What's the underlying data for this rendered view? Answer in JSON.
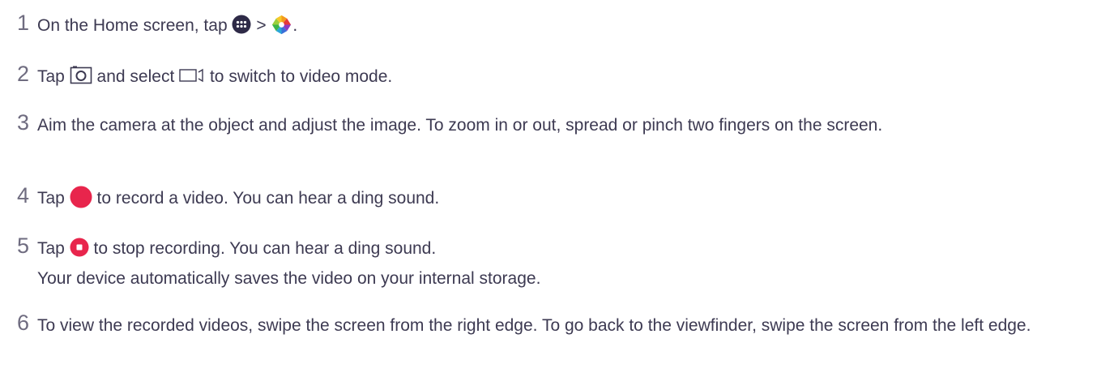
{
  "steps": [
    {
      "number": "1",
      "text_a": "On the Home screen, tap",
      "text_b": ">",
      "text_c": ".",
      "icons": [
        "apps-grid-icon",
        "gallery-aperture-icon"
      ]
    },
    {
      "number": "2",
      "text_a": "Tap",
      "text_b": "and select",
      "text_c": "to switch to video mode.",
      "icons": [
        "camera-mode-icon",
        "video-mode-icon"
      ]
    },
    {
      "number": "3",
      "text_a": "Aim the camera at the object and adjust the image. To zoom in or out, spread or pinch two fingers on the screen."
    },
    {
      "number": "4",
      "text_a": "Tap",
      "text_b": "to record a video. You can hear a ding sound.",
      "icons": [
        "record-button-icon"
      ]
    },
    {
      "number": "5",
      "text_a": "Tap",
      "text_b": "to stop recording. You can hear a ding sound.",
      "note": "Your device automatically saves the video on your internal storage.",
      "icons": [
        "stop-button-icon"
      ]
    },
    {
      "number": "6",
      "text_a": "To view the recorded videos, swipe the screen from the right edge. To go back to the viewfinder, swipe the screen from the left edge."
    }
  ],
  "colors": {
    "text": "#3d3a52",
    "number": "#6f6c80",
    "record_red": "#e8254c",
    "apps_icon_dark": "#2e2a47"
  }
}
